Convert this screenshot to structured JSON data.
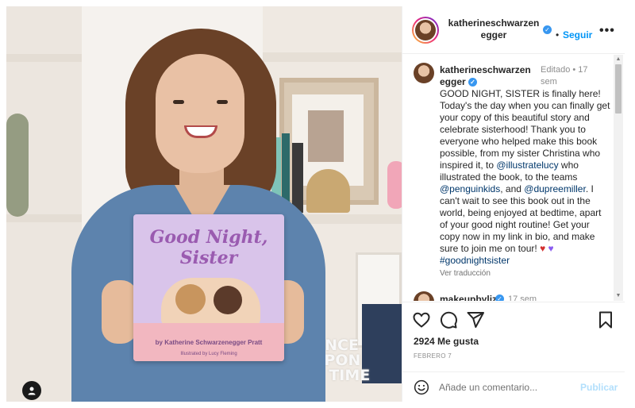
{
  "photo": {
    "book_title": "Good Night, Sister",
    "book_author": "by Katherine Schwarzenegger Pratt",
    "book_illustrator": "Illustrated by Lucy Fleming",
    "decor_letters": "ONCE UPON A TIME",
    "tag_icon": "user-silhouette-icon"
  },
  "header": {
    "username": "katherineschwarzenegger",
    "dot": "•",
    "follow_label": "Seguir",
    "more_icon": "•••"
  },
  "caption": {
    "username": "katherineschwarzenegger",
    "meta": "Editado • 17 sem",
    "text_1": "GOOD NIGHT, SISTER is finally here! Today's the day when you can finally get your copy of this beautiful story and celebrate sisterhood! Thank you to everyone who helped make this book possible, from my sister Christina who inspired it, to ",
    "mention_1": "@illustratelucy",
    "text_2": " who illustrated the book, to the teams ",
    "mention_2": "@penguinkids",
    "text_3": ", and ",
    "mention_3": "@dupreemiller",
    "text_4": ". I can't wait to see this book out in the world, being enjoyed at bedtime, apart of your good night routine! Get your copy now in my link in bio, and make sure to join me on tour! ",
    "heart_1": "♥",
    "heart_2": "♥",
    "hashtag": "#goodnightsister",
    "translate_label": "Ver traducción"
  },
  "comment_2": {
    "username": "makeupbyliz",
    "time": "17 sem"
  },
  "actions": {
    "likes": "2924 Me gusta",
    "date": "FEBRERO 7"
  },
  "comment_box": {
    "placeholder": "Añade un comentario...",
    "publish_label": "Publicar"
  },
  "colors": {
    "accent": "#0095f6",
    "verified": "#3897f0",
    "mention": "#00376b",
    "publish_disabled": "#b2dffc"
  }
}
